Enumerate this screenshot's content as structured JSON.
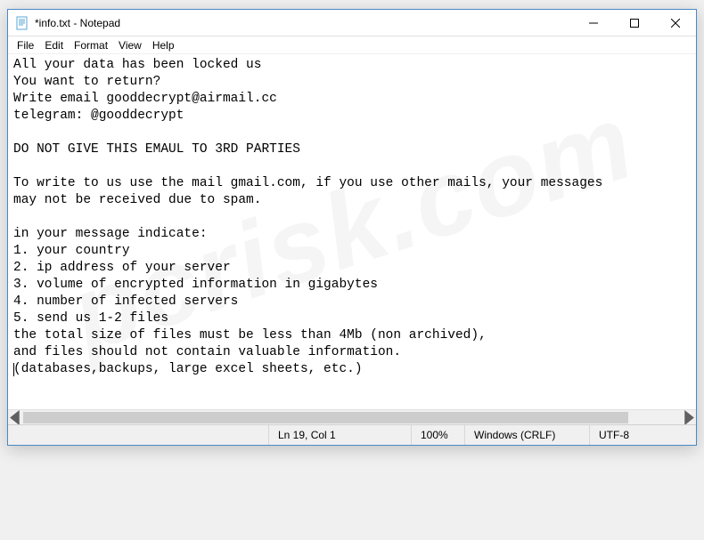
{
  "window": {
    "title": "*info.txt - Notepad"
  },
  "menu": {
    "file": "File",
    "edit": "Edit",
    "format": "Format",
    "view": "View",
    "help": "Help"
  },
  "body": {
    "text": "All your data has been locked us\nYou want to return?\nWrite email gooddecrypt@airmail.cc\ntelegram: @gooddecrypt\n\nDO NOT GIVE THIS EMAUL TO 3RD PARTIES\n\nTo write to us use the mail gmail.com, if you use other mails, your messages\nmay not be received due to spam.\n\nin your message indicate:\n1. your country\n2. ip address of your server\n3. volume of encrypted information in gigabytes\n4. number of infected servers\n5. send us 1-2 files\nthe total size of files must be less than 4Mb (non archived),\nand files should not contain valuable information.\n",
    "last_line": "(databases,backups, large excel sheets, etc.)"
  },
  "status": {
    "position": "Ln 19, Col 1",
    "zoom": "100%",
    "line_ending": "Windows (CRLF)",
    "encoding": "UTF-8"
  },
  "watermark": "pcrisk.com"
}
